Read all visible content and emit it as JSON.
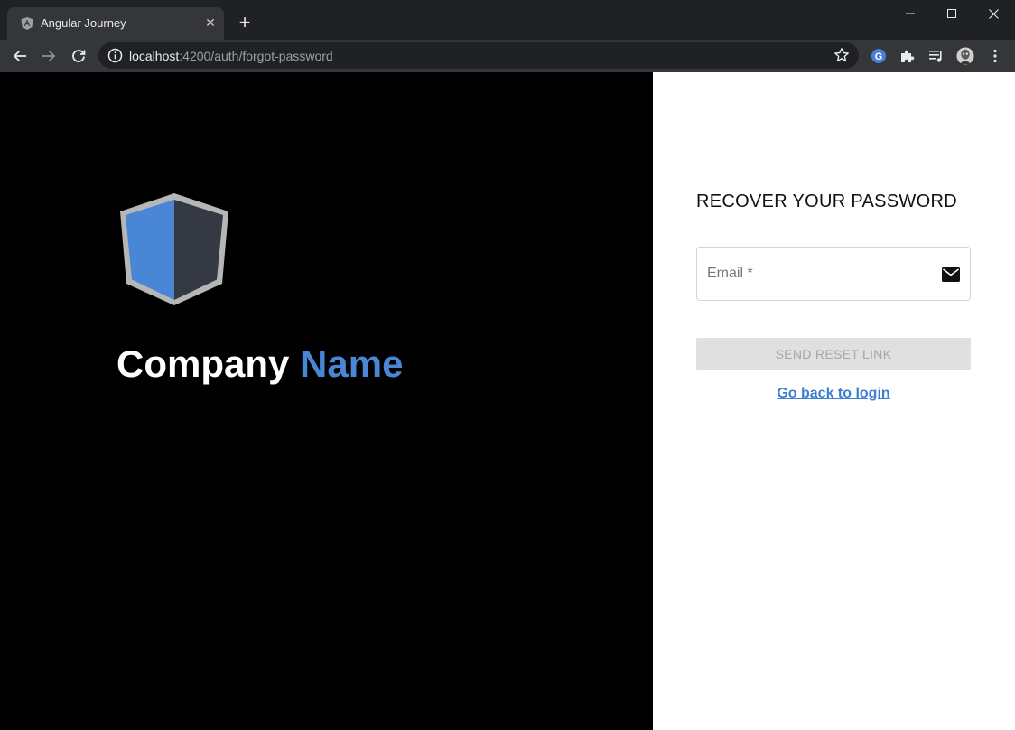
{
  "browser": {
    "tab_title": "Angular Journey",
    "tab_close_glyph": "✕",
    "new_tab_glyph": "+",
    "url_host": "localhost",
    "url_path": ":4200/auth/forgot-password"
  },
  "brand": {
    "name_first": "Company",
    "name_second": "Name",
    "primary_color": "#4a86d6",
    "shield_dark_color": "#353944"
  },
  "form": {
    "heading": "RECOVER YOUR PASSWORD",
    "email_placeholder": "Email *",
    "email_value": "",
    "submit_label": "SEND RESET LINK",
    "back_link": "Go back to login"
  }
}
